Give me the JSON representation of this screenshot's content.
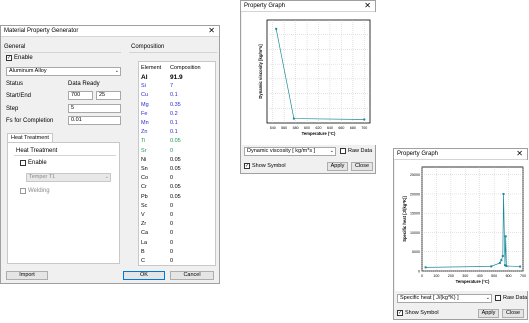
{
  "main_window": {
    "title": "Material Property Generator",
    "close_glyph": "✕",
    "general": {
      "heading": "General",
      "enable_label": "Enable",
      "enable_checked": true,
      "material": "Aluminum Alloy",
      "status_label": "Status",
      "status_value": "Data Ready",
      "start_end_label": "Start/End",
      "start_value": "700",
      "end_value": "25",
      "step_label": "Step",
      "step_value": "5",
      "fs_label": "Fs for Completion",
      "fs_value": "0.01"
    },
    "heat_treatment": {
      "tab_label": "Heat Treatment",
      "group_label": "Heat Treatment",
      "enable_label": "Enable",
      "enable_checked": false,
      "temper_value": "Temper T1",
      "welding_label": "Welding",
      "welding_checked": false
    },
    "composition": {
      "heading": "Composition",
      "col_element": "Element",
      "col_composition": "Composition",
      "rows": [
        {
          "element": "Al",
          "value": "91.9",
          "color": "#000000",
          "bold": true
        },
        {
          "element": "Si",
          "value": "7",
          "color": "#2a2ad0"
        },
        {
          "element": "Cu",
          "value": "0.1",
          "color": "#2a2ad0"
        },
        {
          "element": "Mg",
          "value": "0.35",
          "color": "#2a2ad0"
        },
        {
          "element": "Fe",
          "value": "0.2",
          "color": "#2a2ad0"
        },
        {
          "element": "Mn",
          "value": "0.1",
          "color": "#2a2ad0"
        },
        {
          "element": "Zn",
          "value": "0.1",
          "color": "#2a2ad0"
        },
        {
          "element": "Ti",
          "value": "0.05",
          "color": "#1e9a4e"
        },
        {
          "element": "Sr",
          "value": "0",
          "color": "#1e9a4e"
        },
        {
          "element": "Ni",
          "value": "0.05",
          "color": "#000000"
        },
        {
          "element": "Sn",
          "value": "0.05",
          "color": "#000000"
        },
        {
          "element": "Co",
          "value": "0",
          "color": "#000000"
        },
        {
          "element": "Cr",
          "value": "0.05",
          "color": "#000000"
        },
        {
          "element": "Pb",
          "value": "0.05",
          "color": "#000000"
        },
        {
          "element": "Sc",
          "value": "0",
          "color": "#000000"
        },
        {
          "element": "V",
          "value": "0",
          "color": "#000000"
        },
        {
          "element": "Zr",
          "value": "0",
          "color": "#000000"
        },
        {
          "element": "Ca",
          "value": "0",
          "color": "#000000"
        },
        {
          "element": "La",
          "value": "0",
          "color": "#000000"
        },
        {
          "element": "B",
          "value": "0",
          "color": "#000000"
        },
        {
          "element": "C",
          "value": "0",
          "color": "#000000"
        }
      ]
    },
    "buttons": {
      "import": "Import",
      "ok": "OK",
      "cancel": "Cancel"
    }
  },
  "graph1": {
    "title": "Property Graph",
    "close_glyph": "✕",
    "property_combo": "Dynamic viscosity [ kg/m*s ]",
    "raw_data_label": "Raw Data",
    "show_symbol_label": "Show Symbol",
    "apply": "Apply",
    "close": "Close"
  },
  "graph2": {
    "title": "Property Graph",
    "close_glyph": "✕",
    "property_combo": "Specific heat [ J/(kg*K) ]",
    "raw_data_label": "Raw Data",
    "show_symbol_label": "Show Symbol",
    "apply": "Apply",
    "close": "Close"
  },
  "chart_data": [
    {
      "type": "line",
      "xlabel": "Temperature (°C)",
      "ylabel": "Dynamic viscosity [kg/m*s]",
      "xlim": [
        530,
        710
      ],
      "ylim": [
        0,
        0.035
      ],
      "xticks": [
        "540",
        "560",
        "580",
        "600",
        "620",
        "640",
        "660",
        "680",
        "700"
      ],
      "grid": true,
      "x": [
        546,
        577,
        700
      ],
      "y": [
        0.032,
        0.0015,
        0.0012
      ],
      "color": "#1b8a9a"
    },
    {
      "type": "line",
      "xlabel": "Temperature (°C)",
      "ylabel": "Specific heat [J/(kg*K)]",
      "xlim": [
        0,
        700
      ],
      "ylim": [
        0,
        27000
      ],
      "yticks": [
        "0",
        "5000",
        "10000",
        "15000",
        "20000",
        "25000"
      ],
      "xticks": [
        "0",
        "100",
        "200",
        "300",
        "400",
        "500",
        "600",
        "700"
      ],
      "grid": true,
      "x": [
        25,
        480,
        540,
        550,
        560,
        565,
        575,
        580,
        585,
        680
      ],
      "y": [
        950,
        1200,
        2100,
        2800,
        3900,
        20000,
        1500,
        9000,
        1300,
        1150
      ],
      "color": "#1b8a9a"
    }
  ]
}
